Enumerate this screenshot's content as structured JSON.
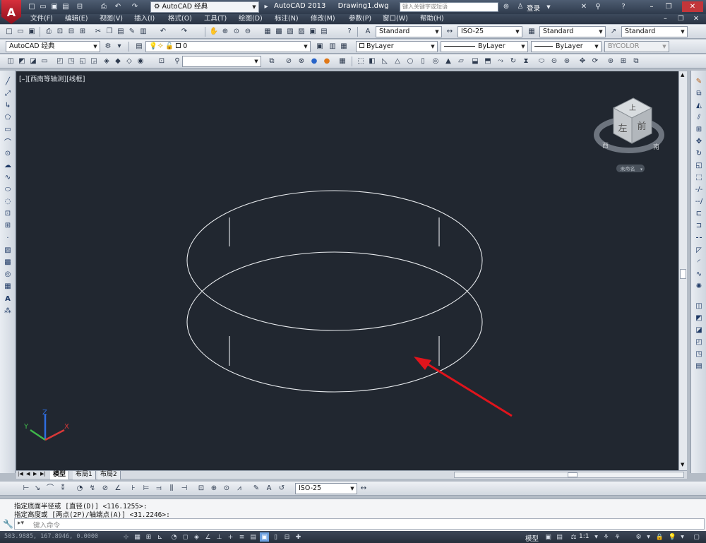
{
  "app": {
    "name": "AutoCAD 2013",
    "document": "Drawing1.dwg",
    "workspace": "AutoCAD 经典",
    "search_placeholder": "键入关键字或短语",
    "login": "登录"
  },
  "menu": [
    "文件(F)",
    "编辑(E)",
    "视图(V)",
    "插入(I)",
    "格式(O)",
    "工具(T)",
    "绘图(D)",
    "标注(N)",
    "修改(M)",
    "参数(P)",
    "窗口(W)",
    "帮助(H)"
  ],
  "styles": {
    "text_style": "Standard",
    "dim_style": "ISO-25",
    "table_style": "Standard",
    "multileader_style": "Standard"
  },
  "layers": {
    "workspace_combo": "AutoCAD 经典",
    "current_layer": "0",
    "color": "ByLayer",
    "linetype": "ByLayer",
    "lineweight": "ByLayer",
    "plotstyle": "BYCOLOR"
  },
  "viewport": {
    "label": "[–][西南等轴测][线框]",
    "background": "#212730",
    "viewcube": {
      "top": "上",
      "left": "左",
      "front": "前",
      "west": "西",
      "south": "南",
      "unnamed": "未命名"
    },
    "ucs": {
      "x": "X",
      "y": "Y",
      "z": "Z"
    }
  },
  "tabs": [
    "模型",
    "布局1",
    "布局2"
  ],
  "dim_toolbar": {
    "dim_style": "ISO-25"
  },
  "command": {
    "history": [
      "指定底面半径或 [直径(D)] <116.1255>:",
      "指定高度或 [两点(2P)/轴端点(A)] <31.2246>:"
    ],
    "placeholder": "键入命令"
  },
  "status": {
    "coords": "503.9885, 167.8946, 0.0000",
    "model": "模型",
    "scale": "1:1"
  },
  "accent": {
    "arrow": "#e0141c",
    "brand": "#c8102e"
  }
}
